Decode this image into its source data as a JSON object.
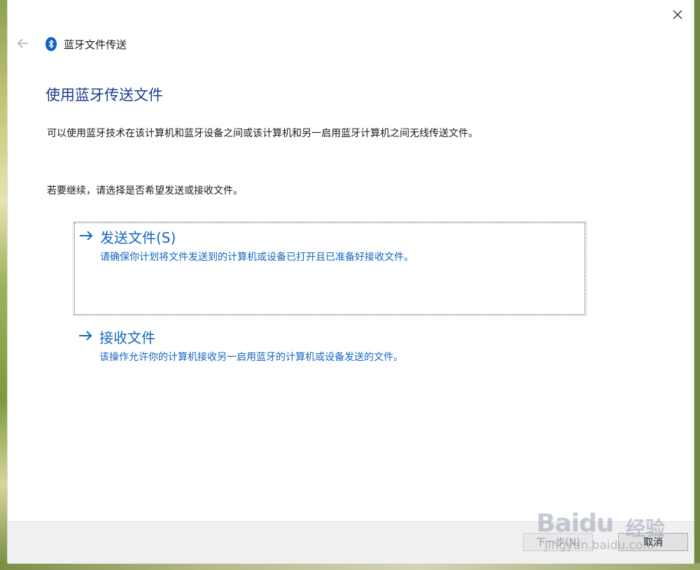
{
  "window": {
    "title": "蓝牙文件传送",
    "close_icon": "close-icon",
    "back_icon": "back-arrow-icon",
    "app_icon": "bluetooth-icon"
  },
  "page": {
    "heading": "使用蓝牙传送文件",
    "description": "可以使用蓝牙技术在该计算机和蓝牙设备之间或该计算机和另一启用蓝牙计算机之间无线传送文件。",
    "prompt": "若要继续，请选择是否希望发送或接收文件。"
  },
  "options": {
    "send": {
      "title": "发送文件(S)",
      "description": "请确保你计划将文件发送到的计算机或设备已打开且已准备好接收文件。"
    },
    "receive": {
      "title": "接收文件",
      "description": "该操作允许你的计算机接收另一启用蓝牙的计算机或设备发送的文件。"
    }
  },
  "footer": {
    "next_label": "下一步(N)",
    "cancel_label": "取消"
  },
  "watermark": {
    "brand": "Baidu",
    "brand_cn": "经验",
    "url": "jingyan.baidu.com"
  },
  "colors": {
    "heading": "#1a3d8f",
    "link": "#1565c0",
    "footer_bg": "#f0f0f0"
  }
}
